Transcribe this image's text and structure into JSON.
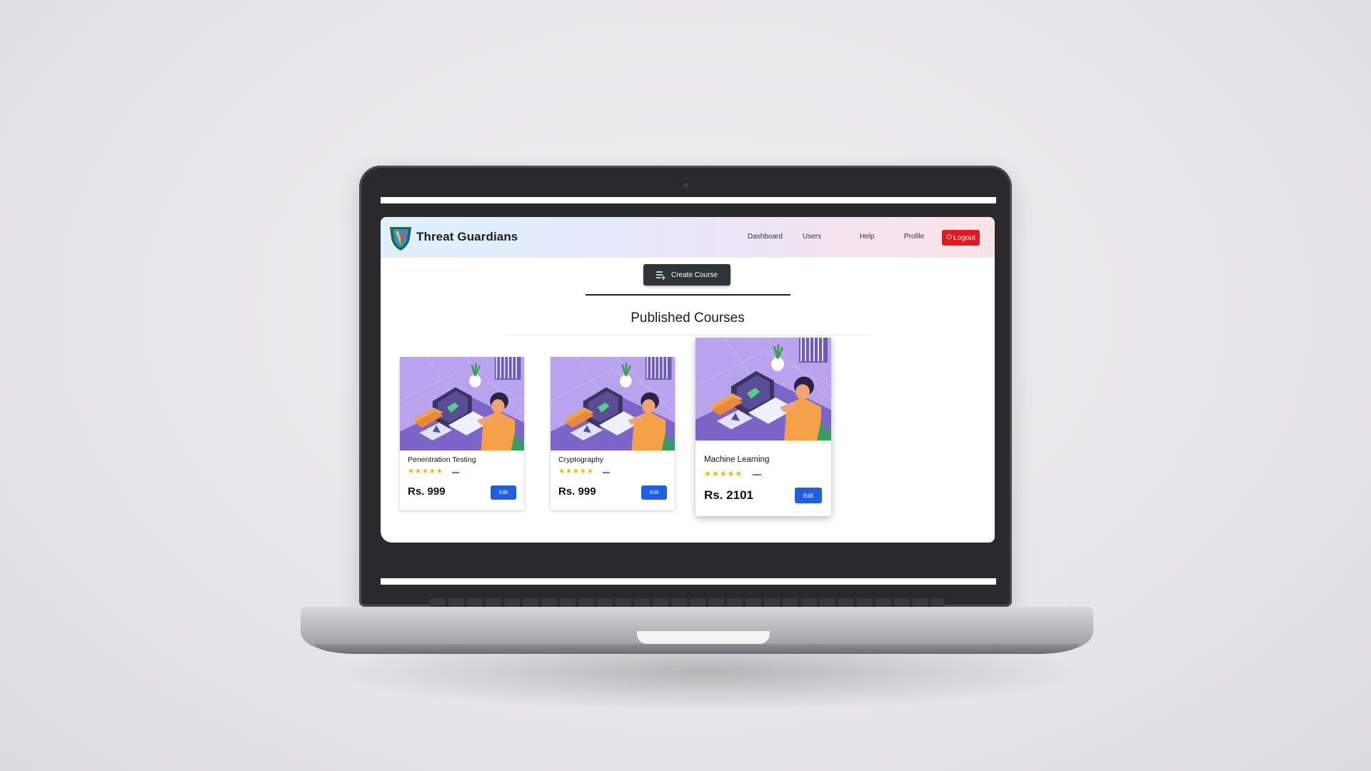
{
  "app": {
    "brand": "Threat Guardians"
  },
  "nav": {
    "items": [
      {
        "label": "Dashboard"
      },
      {
        "label": "Users"
      },
      {
        "label": "Help"
      },
      {
        "label": "Profile"
      }
    ],
    "logout_label": "Logout"
  },
  "actions": {
    "create_course_label": "Create Course"
  },
  "section": {
    "title": "Published Courses"
  },
  "courses": [
    {
      "title": "Penentration Testing",
      "rating_stars": "★★★★★",
      "price": "Rs. 999",
      "edit_label": "Edit"
    },
    {
      "title": "Cryptography",
      "rating_stars": "★★★★★",
      "price": "Rs. 999",
      "edit_label": "Edit"
    },
    {
      "title": "Machine Learning",
      "rating_stars": "★★★★★",
      "price": "Rs. 2101",
      "edit_label": "Edit"
    }
  ],
  "icons": {
    "logo": "shield-logo-icon",
    "logout": "power-icon",
    "create": "add-list-icon"
  },
  "colors": {
    "logout_bg": "#e3191f",
    "edit_bg": "#1f5fe0",
    "create_bg": "#2f3439",
    "stars": "#f2b800",
    "card_image_bg": "#b9a3ee"
  }
}
